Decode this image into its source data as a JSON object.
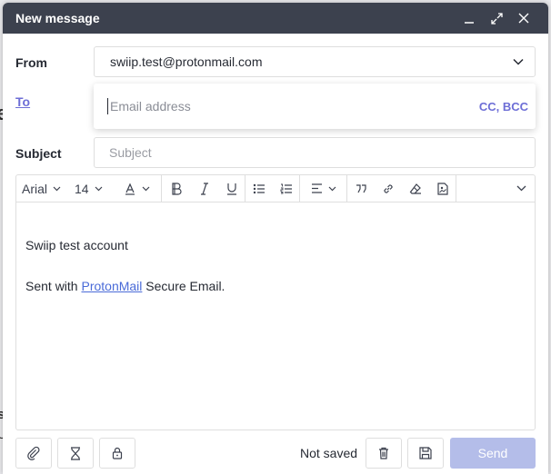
{
  "window": {
    "title": "New message"
  },
  "background_fragments": [
    "e",
    "s",
    "U"
  ],
  "from": {
    "label": "From",
    "value": "swiip.test@protonmail.com"
  },
  "to": {
    "label": "To",
    "placeholder": "Email address",
    "cc_bcc_label": "CC, BCC"
  },
  "subject": {
    "label": "Subject",
    "placeholder": "Subject",
    "value": ""
  },
  "toolbar": {
    "font_family": "Arial",
    "font_size": "14"
  },
  "body": {
    "signature_line": "Swiip test account",
    "sent_prefix": "Sent with ",
    "sent_link": "ProtonMail",
    "sent_suffix": " Secure Email."
  },
  "footer": {
    "status": "Not saved",
    "send_label": "Send"
  },
  "colors": {
    "titlebar": "#3c414e",
    "accent": "#6d6ed6",
    "link": "#4a6bd8",
    "send_disabled": "#b4bde9"
  }
}
